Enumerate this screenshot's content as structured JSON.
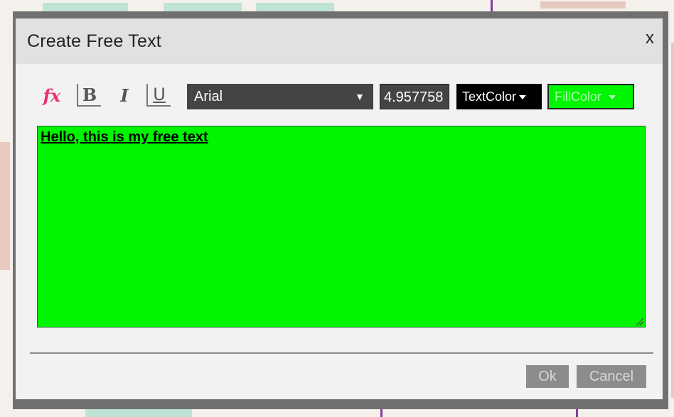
{
  "dialog": {
    "title": "Create Free Text",
    "close_label": "x"
  },
  "toolbar": {
    "fx_label": "fx",
    "bold_label": "B",
    "italic_label": "I",
    "underline_label": "U",
    "font_family_value": "Arial",
    "font_size_value": "4.957758",
    "text_color_label": "TextColor",
    "fill_color_label": "FillColor"
  },
  "editor": {
    "text": "Hello, this is my free text",
    "fill_color": "#00f500"
  },
  "buttons": {
    "ok_label": "Ok",
    "cancel_label": "Cancel"
  },
  "icons": {
    "fx": "function-icon",
    "bold": "bold-icon",
    "italic": "italic-icon",
    "underline": "underline-icon",
    "dropdown": "chevron-down-icon",
    "resize": "resize-grip-icon"
  }
}
